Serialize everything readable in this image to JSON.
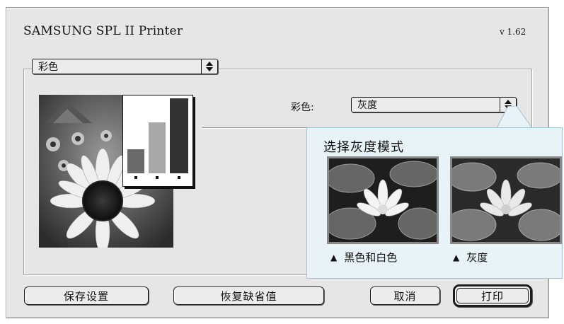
{
  "dialog": {
    "title": "SAMSUNG SPL II Printer",
    "version": "v 1.62"
  },
  "main_popup": {
    "value": "彩色",
    "icon": "updown-arrows-icon"
  },
  "color_setting": {
    "label": "彩色:",
    "value": "灰度",
    "icon": "updown-arrows-icon"
  },
  "callout": {
    "title": "选择灰度模式",
    "options": [
      {
        "label": "黑色和白色",
        "marker": "▲"
      },
      {
        "label": "灰度",
        "marker": "▲"
      }
    ]
  },
  "buttons": {
    "save": "保存设置",
    "restore": "恢复缺省值",
    "cancel": "取消",
    "print": "打印"
  },
  "colors": {
    "dialog_bg": "#e6e6e6",
    "callout_bg": "#e8f3f7",
    "callout_border": "#9fc5d4"
  }
}
